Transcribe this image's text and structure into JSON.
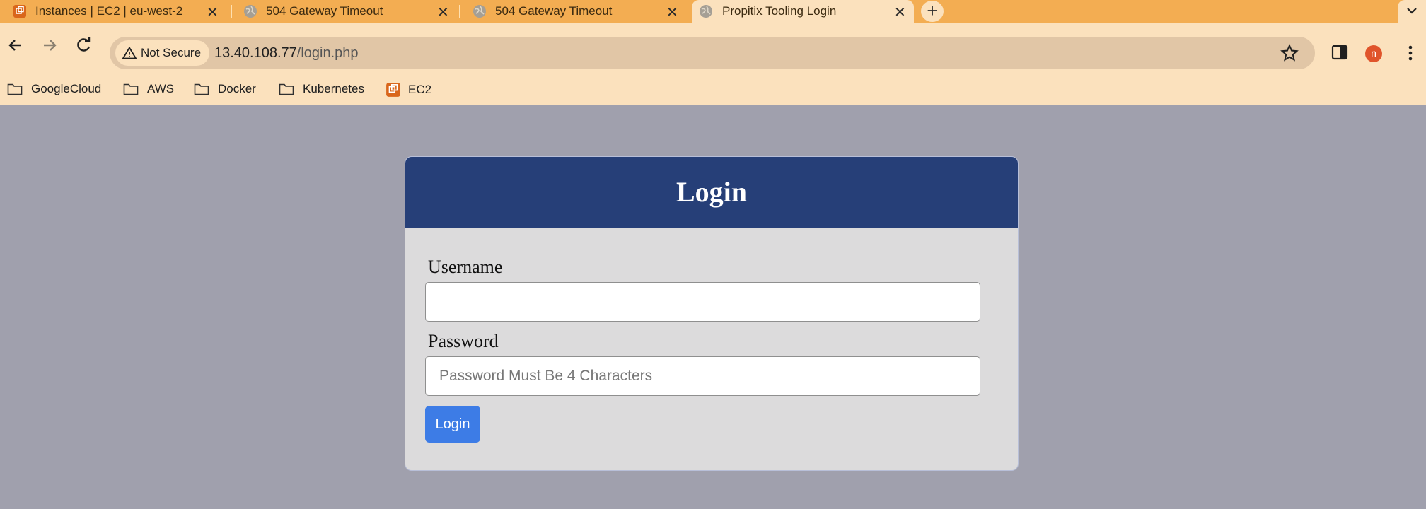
{
  "browser": {
    "tabs": [
      {
        "title": "Instances | EC2 | eu-west-2",
        "favicon": "aws-icon",
        "active": false
      },
      {
        "title": "504 Gateway Timeout",
        "favicon": "globe-icon",
        "active": false
      },
      {
        "title": "504 Gateway Timeout",
        "favicon": "globe-icon",
        "active": false
      },
      {
        "title": "Propitix Tooling Login",
        "favicon": "globe-icon",
        "active": true
      }
    ],
    "security_label": "Not Secure",
    "url_host": "13.40.108.77",
    "url_path": "/login.php",
    "profile_initial": "n",
    "bookmarks": [
      {
        "label": "GoogleCloud",
        "icon": "folder-icon"
      },
      {
        "label": "AWS",
        "icon": "folder-icon"
      },
      {
        "label": "Docker",
        "icon": "folder-icon"
      },
      {
        "label": "Kubernetes",
        "icon": "folder-icon"
      },
      {
        "label": "EC2",
        "icon": "aws-icon"
      }
    ]
  },
  "login": {
    "heading": "Login",
    "username_label": "Username",
    "username_value": "",
    "password_label": "Password",
    "password_placeholder": "Password Must Be 4 Characters",
    "submit_label": "Login"
  },
  "colors": {
    "tab_strip": "#f3ad52",
    "toolbar": "#fbe1bd",
    "page_background": "#a0a0ad",
    "header": "#263f78",
    "card": "#dcdbdc",
    "button": "#3d7ce6",
    "avatar": "#e0542b"
  }
}
